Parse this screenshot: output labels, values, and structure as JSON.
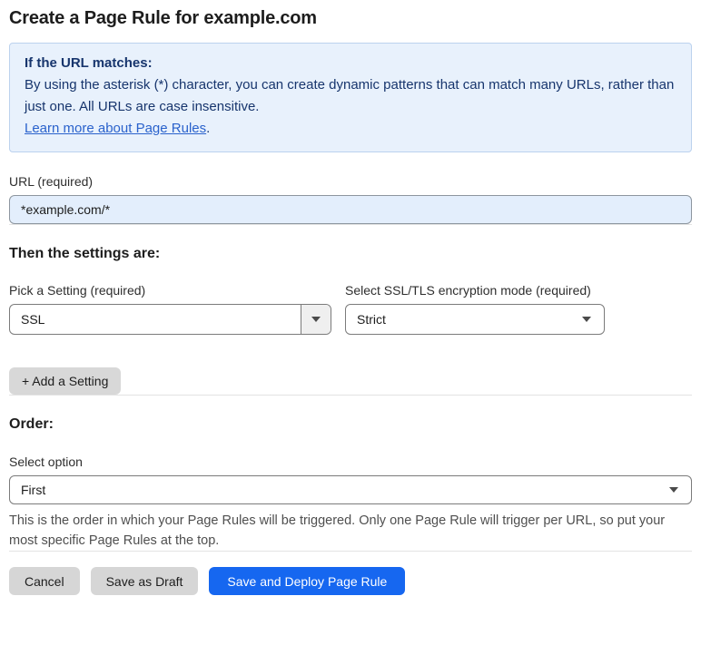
{
  "page": {
    "title": "Create a Page Rule for example.com"
  },
  "info_box": {
    "heading": "If the URL matches:",
    "body": "By using the asterisk (*) character, you can create dynamic patterns that can match many URLs, rather than just one. All URLs are case insensitive.",
    "link_text": "Learn more about Page Rules",
    "link_suffix": "."
  },
  "url_field": {
    "label": "URL (required)",
    "value": "*example.com/*"
  },
  "settings_section": {
    "heading": "Then the settings are:",
    "setting_picker": {
      "label": "Pick a Setting (required)",
      "value": "SSL"
    },
    "ssl_mode_picker": {
      "label": "Select SSL/TLS encryption mode (required)",
      "value": "Strict"
    },
    "add_setting_label": "+ Add a Setting"
  },
  "order_section": {
    "heading": "Order:",
    "select_label": "Select option",
    "value": "First",
    "help_text": "This is the order in which your Page Rules will be triggered. Only one Page Rule will trigger per URL, so put your most specific Page Rules at the top."
  },
  "footer": {
    "cancel_label": "Cancel",
    "save_draft_label": "Save as Draft",
    "save_deploy_label": "Save and Deploy Page Rule"
  },
  "colors": {
    "info_box_bg": "#e8f1fc",
    "info_box_border": "#bcd2ee",
    "info_text": "#17356d",
    "link": "#2a62cc",
    "url_input_bg": "#e3eefc",
    "primary_button": "#1667f0",
    "gray_button": "#d6d6d6"
  }
}
